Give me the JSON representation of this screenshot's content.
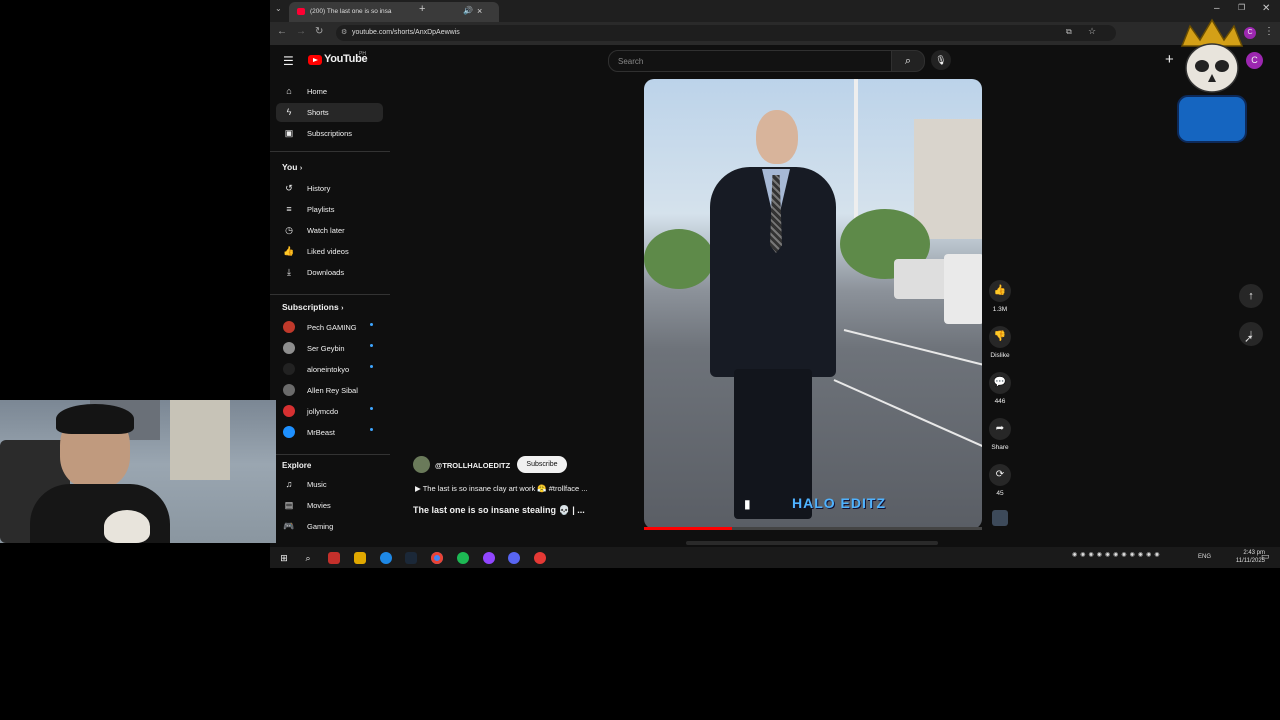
{
  "browser": {
    "tab_title": "(200) The last one is so insa",
    "url": "youtube.com/shorts/AnxDpAewwis",
    "profile_initial": "C"
  },
  "youtube": {
    "logo_text": "YouTube",
    "country_code": "PH",
    "search_placeholder": "Search",
    "avatar_initial": "C"
  },
  "sidebar": {
    "main": [
      {
        "label": "Home",
        "icon": "home-icon"
      },
      {
        "label": "Shorts",
        "icon": "shorts-icon",
        "active": true
      },
      {
        "label": "Subscriptions",
        "icon": "subscriptions-icon"
      }
    ],
    "you_heading": "You",
    "you": [
      {
        "label": "History",
        "icon": "history-icon"
      },
      {
        "label": "Playlists",
        "icon": "playlists-icon"
      },
      {
        "label": "Watch later",
        "icon": "watch-later-icon"
      },
      {
        "label": "Liked videos",
        "icon": "like-icon"
      },
      {
        "label": "Downloads",
        "icon": "download-icon"
      }
    ],
    "subs_heading": "Subscriptions",
    "subscriptions": [
      {
        "label": "Pech GAMING",
        "color": "#c0392b",
        "new": true
      },
      {
        "label": "Ser Geybin",
        "color": "#8e8e8e",
        "new": true
      },
      {
        "label": "aloneintokyo",
        "color": "#222222",
        "new": true
      },
      {
        "label": "Allen Rey Sibal",
        "color": "#6b6b6b",
        "new": false
      },
      {
        "label": "jollymcdo",
        "color": "#d63031",
        "new": true
      },
      {
        "label": "MrBeast",
        "color": "#1e90ff",
        "new": true
      }
    ],
    "explore_heading": "Explore",
    "explore": [
      {
        "label": "Music",
        "icon": "music-icon"
      },
      {
        "label": "Movies",
        "icon": "movies-icon"
      },
      {
        "label": "Gaming",
        "icon": "gaming-icon"
      }
    ]
  },
  "short": {
    "channel": "@TROLLHALOEDITZ",
    "subscribe_label": "Subscribe",
    "description": "▶ The last is so insane clay art work 😤 #trollface ...",
    "title": "The last one is so insane stealing 💀 | ...",
    "watermark": "HALO EDITZ",
    "progress": 0.26
  },
  "actions": {
    "likes": "1.3M",
    "dislike_label": "Dislike",
    "comments": "446",
    "share_label": "Share",
    "remix": "45"
  },
  "taskbar": {
    "language": "ENG",
    "time": "2:43 pm",
    "date": "11/11/2025"
  }
}
